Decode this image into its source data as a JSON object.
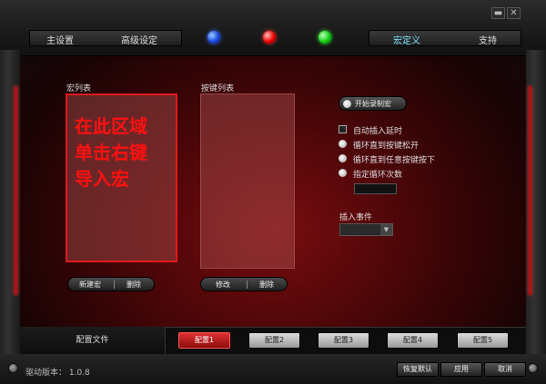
{
  "window": {
    "minimize": "▬",
    "close": "✕"
  },
  "nav": {
    "left_tabs": [
      {
        "label": "主设置"
      },
      {
        "label": "高级设定"
      }
    ],
    "right_tabs": [
      {
        "label": "宏定义"
      },
      {
        "label": "支持"
      }
    ],
    "active": "宏定义"
  },
  "macro": {
    "label": "宏列表",
    "hint": "在此区域\n单击右键\n导入宏",
    "new_btn": "新建宏",
    "delete_btn": "删除"
  },
  "keys": {
    "label": "按键列表",
    "edit_btn": "修改",
    "delete_btn": "删除"
  },
  "record": {
    "label": "开始录制宏"
  },
  "options": {
    "auto_delay": "自动插入延时",
    "loop_release": "循环直到按键松开",
    "loop_any": "循环直到任意按键按下",
    "loop_count": "指定循环次数"
  },
  "insert": {
    "label": "插入事件"
  },
  "profile": {
    "label": "配置文件",
    "configs": [
      "配置1",
      "配置2",
      "配置3",
      "配置4",
      "配置5"
    ],
    "active_index": 0
  },
  "footer": {
    "driver_version": "驱动版本： 1.0.8",
    "reset_btn": "恢复默认",
    "apply_btn": "应用",
    "cancel_btn": "取消"
  },
  "colors": {
    "accent": "#e21a1a",
    "active_tab": "#7fe3ff"
  }
}
